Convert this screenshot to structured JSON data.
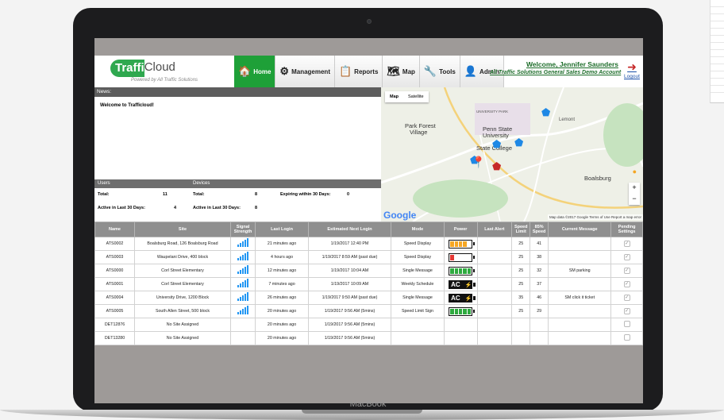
{
  "device": {
    "label": "MacBook"
  },
  "header": {
    "logo_mark": "Traffi",
    "logo_rest": "Cloud",
    "logo_tagline": "Powered by All Traffic Solutions",
    "nav": [
      {
        "label": "Home",
        "icon": "home-icon",
        "glyph": "🏠",
        "active": true
      },
      {
        "label": "Management",
        "icon": "gears-icon",
        "glyph": "⚙"
      },
      {
        "label": "Reports",
        "icon": "reports-icon",
        "glyph": "📋"
      },
      {
        "label": "Map",
        "icon": "map-icon",
        "glyph": "🗺"
      },
      {
        "label": "Tools",
        "icon": "wrench-icon",
        "glyph": "🔧"
      },
      {
        "label": "Admin",
        "icon": "admin-user-icon",
        "glyph": "👤"
      }
    ],
    "welcome": "Welcome, Jennifer Saunders",
    "account": "All Traffic Solutions General Sales Demo Account",
    "logout": "Logout"
  },
  "news": {
    "title": "News:",
    "body": "Welcome to Trafficloud!"
  },
  "stats": {
    "users_label": "Users",
    "devices_label": "Devices",
    "users_total_label": "Total:",
    "users_total": "11",
    "users_active_label": "Active in Last 30 Days:",
    "users_active": "4",
    "devices_total_label": "Total:",
    "devices_total": "8",
    "devices_active_label": "Active in Last 30 Days:",
    "devices_active": "8",
    "expiring_label": "Expiring within 30 Days:",
    "expiring": "0"
  },
  "map": {
    "tab_map": "Map",
    "tab_satellite": "Satellite",
    "google": "Google",
    "footer": "Map data ©2017 Google   Terms of Use   Report a map error",
    "places": {
      "park_forest": "Park Forest",
      "village": "Village",
      "penn_state": "Penn State",
      "university": "University",
      "state_college": "State College",
      "boalsburg": "Boalsburg",
      "university_park": "UNIVERSITY PARK",
      "lemont": "Lemont"
    },
    "zoom_in": "+",
    "zoom_out": "−"
  },
  "table": {
    "headers": [
      "Name",
      "Site",
      "Signal Strength",
      "Last Login",
      "Estimated Next Login",
      "Mode",
      "Power",
      "Last Alert",
      "Speed Limit",
      "85% Speed",
      "Current Message",
      "Pending Settings"
    ],
    "rows": [
      {
        "name": "ATS0002",
        "site": "Boalsburg Road, 126 Boalsburg Road",
        "signal": 4,
        "last_login": "21 minutes ago",
        "next_login": "1/19/2017 12:40 PM",
        "mode": "Speed Display",
        "power": "battery-orange",
        "last_alert": "",
        "speed_limit": "25",
        "speed85": "41",
        "message": "",
        "pending": true
      },
      {
        "name": "ATS0003",
        "site": "Waupelani Drive, 400 block",
        "signal": 4,
        "last_login": "4 hours ago",
        "next_login": "1/19/2017 8:59 AM (past due)",
        "mode": "Speed Display",
        "power": "battery-red",
        "last_alert": "",
        "speed_limit": "25",
        "speed85": "38",
        "message": "",
        "pending": true
      },
      {
        "name": "ATS0000",
        "site": "Corl Street Elementary",
        "signal": 4,
        "last_login": "12 minutes ago",
        "next_login": "1/19/2017 10:04 AM",
        "mode": "Single Message",
        "power": "battery-green",
        "last_alert": "",
        "speed_limit": "25",
        "speed85": "32",
        "message": "SM parking",
        "pending": true
      },
      {
        "name": "ATS0001",
        "site": "Corl Street Elementary",
        "signal": 4,
        "last_login": "7 minutes ago",
        "next_login": "1/19/2017 10:09 AM",
        "mode": "Weekly Schedule",
        "power": "ac",
        "last_alert": "",
        "speed_limit": "25",
        "speed85": "37",
        "message": "",
        "pending": true
      },
      {
        "name": "ATS0004",
        "site": "University Drive, 1200 Block",
        "signal": 4,
        "last_login": "26 minutes ago",
        "next_login": "1/19/2017 9:50 AM (past due)",
        "mode": "Single Message",
        "power": "ac",
        "last_alert": "",
        "speed_limit": "35",
        "speed85": "46",
        "message": "SM click it ticket",
        "pending": true
      },
      {
        "name": "ATS0005",
        "site": "South Allen Street, 500 block",
        "signal": 4,
        "last_login": "20 minutes ago",
        "next_login": "1/19/2017 9:56 AM (5mins)",
        "mode": "Speed Limit Sign",
        "power": "battery-green",
        "last_alert": "",
        "speed_limit": "25",
        "speed85": "29",
        "message": "",
        "pending": true
      },
      {
        "name": "DET12876",
        "site": "No Site Assigned",
        "signal": 0,
        "last_login": "20 minutes ago",
        "next_login": "1/19/2017 9:56 AM (5mins)",
        "mode": "",
        "power": "",
        "last_alert": "",
        "speed_limit": "",
        "speed85": "",
        "message": "",
        "pending": false
      },
      {
        "name": "DET13280",
        "site": "No Site Assigned",
        "signal": 0,
        "last_login": "20 minutes ago",
        "next_login": "1/19/2017 9:56 AM (5mins)",
        "mode": "",
        "power": "",
        "last_alert": "",
        "speed_limit": "",
        "speed85": "",
        "message": "",
        "pending": false
      }
    ]
  },
  "colors": {
    "brand_green": "#1ea038",
    "header_gray": "#8f8f8f",
    "signal_blue": "#2196f3"
  }
}
